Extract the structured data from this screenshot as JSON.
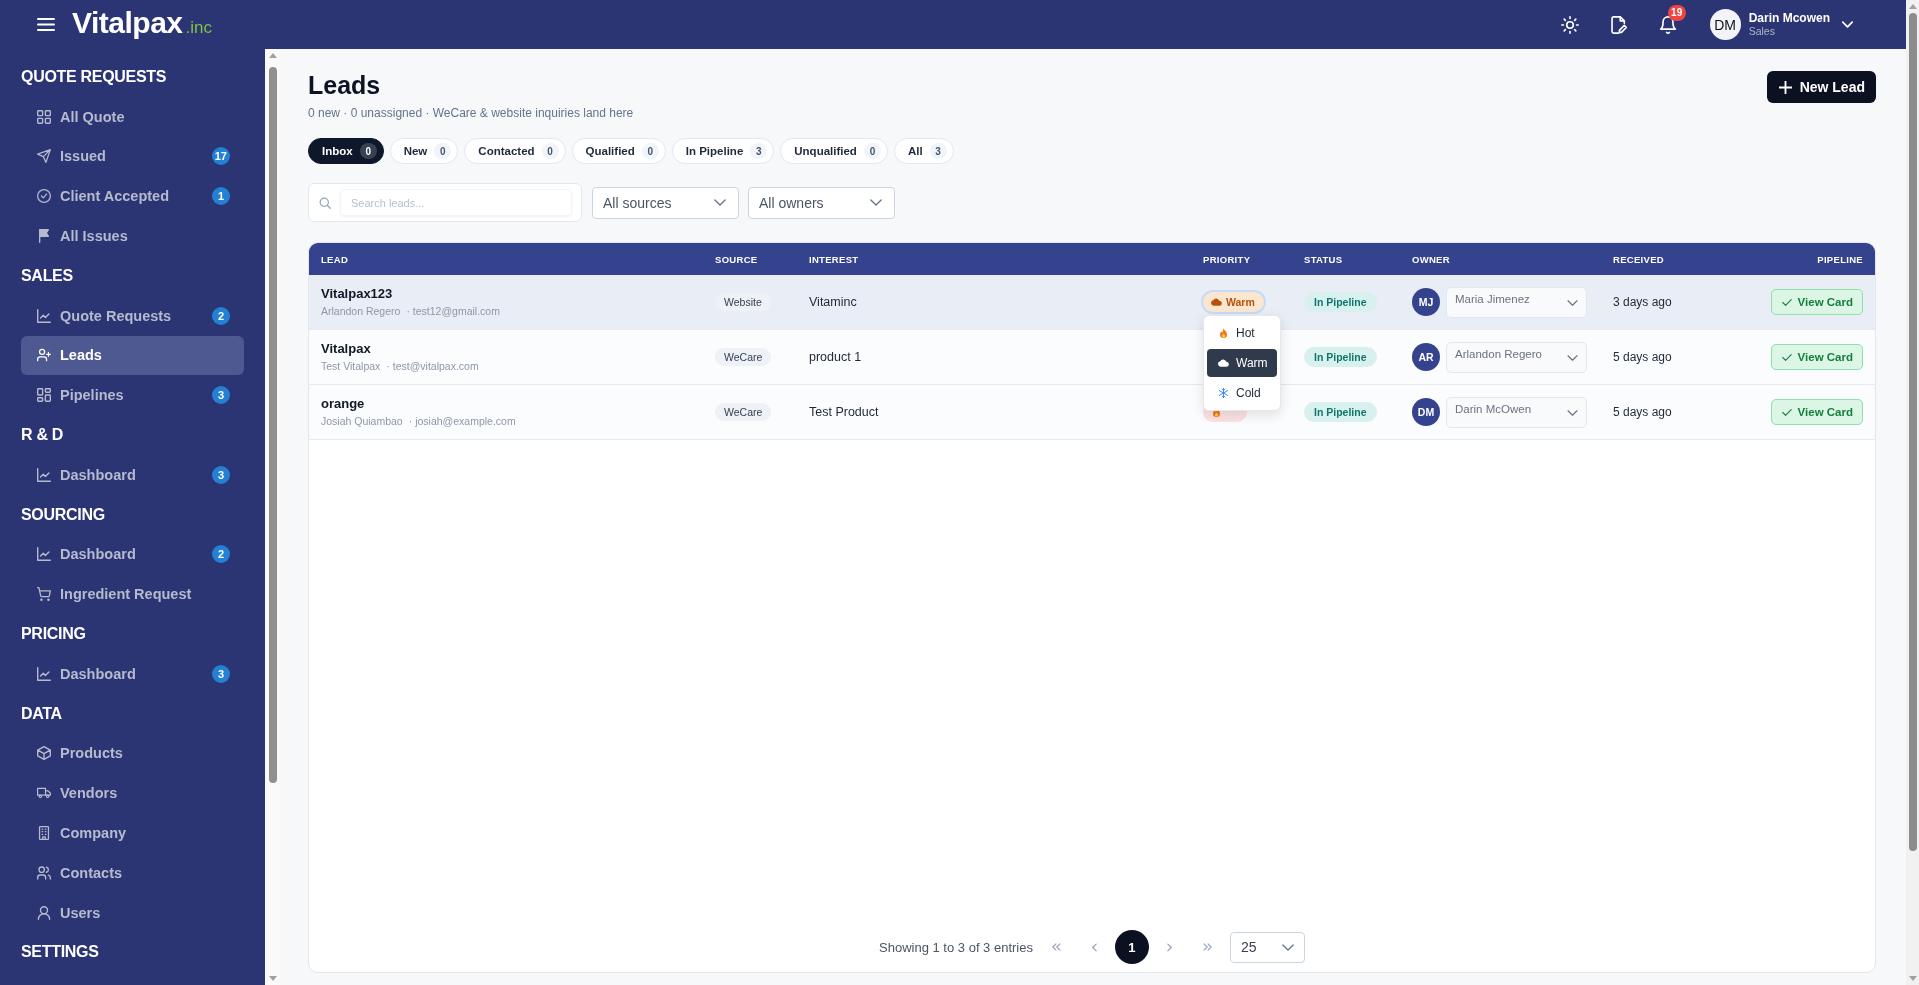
{
  "topbar": {
    "logo": {
      "name": "Vitalpax",
      "suffix": ".inc"
    },
    "notifications": "19",
    "user": {
      "initials": "DM",
      "name": "Darin Mcowen",
      "role": "Sales"
    }
  },
  "sidebar": {
    "sections": [
      {
        "title": "QUOTE REQUESTS",
        "items": [
          {
            "label": "All Quote",
            "selected": false
          },
          {
            "label": "Issued",
            "badge": "17",
            "selected": false
          },
          {
            "label": "Client Accepted",
            "badge": "1",
            "selected": false
          },
          {
            "label": "All Issues",
            "selected": false
          }
        ]
      },
      {
        "title": "SALES",
        "items": [
          {
            "label": "Quote Requests",
            "badge": "2",
            "selected": false
          },
          {
            "label": "Leads",
            "selected": true
          },
          {
            "label": "Pipelines",
            "badge": "3",
            "selected": false
          }
        ]
      },
      {
        "title": "R & D",
        "items": [
          {
            "label": "Dashboard",
            "badge": "3",
            "selected": false
          }
        ]
      },
      {
        "title": "SOURCING",
        "items": [
          {
            "label": "Dashboard",
            "badge": "2",
            "selected": false
          },
          {
            "label": "Ingredient Request",
            "selected": false
          }
        ]
      },
      {
        "title": "PRICING",
        "items": [
          {
            "label": "Dashboard",
            "badge": "3",
            "selected": false
          }
        ]
      },
      {
        "title": "DATA",
        "items": [
          {
            "label": "Products",
            "selected": false
          },
          {
            "label": "Vendors",
            "selected": false
          },
          {
            "label": "Company",
            "selected": false
          },
          {
            "label": "Contacts",
            "selected": false
          },
          {
            "label": "Users",
            "selected": false
          }
        ]
      },
      {
        "title": "SETTINGS"
      }
    ]
  },
  "page": {
    "title": "Leads",
    "subtitle": "0 new · 0 unassigned · WeCare & website inquiries land here",
    "new_button": "New Lead"
  },
  "tabs": [
    {
      "label": "Inbox",
      "count": "0",
      "selected": true
    },
    {
      "label": "New",
      "count": "0",
      "selected": false
    },
    {
      "label": "Contacted",
      "count": "0",
      "selected": false
    },
    {
      "label": "Qualified",
      "count": "0",
      "selected": false
    },
    {
      "label": "In Pipeline",
      "count": "3",
      "selected": false
    },
    {
      "label": "Unqualified",
      "count": "0",
      "selected": false
    },
    {
      "label": "All",
      "count": "3",
      "selected": false
    }
  ],
  "search": {
    "placeholder": "Search leads..."
  },
  "filters": [
    {
      "value": "All sources"
    },
    {
      "value": "All owners"
    }
  ],
  "table": {
    "columns": [
      "LEAD",
      "SOURCE",
      "INTEREST",
      "PRIORITY",
      "STATUS",
      "OWNER",
      "RECEIVED",
      "PIPELINE"
    ],
    "rows": [
      {
        "hovered": true,
        "lead": "Vitalpax123",
        "contact": "Arlandon Regero",
        "email": "· test12@gmail.com",
        "source": "Website",
        "interest": "Vitaminc",
        "priority": {
          "label": "Warm",
          "kind": "warm",
          "menu": [
            {
              "label": "Hot",
              "kind": "hot",
              "selected": false
            },
            {
              "label": "Warm",
              "kind": "warm",
              "selected": true
            },
            {
              "label": "Cold",
              "kind": "cold",
              "selected": false
            }
          ]
        },
        "status": "In Pipeline",
        "owner": {
          "initials": "MJ",
          "value": "Maria Jimenez"
        },
        "received": "3 days ago",
        "action": "View Card"
      },
      {
        "hovered": false,
        "lead": "Vitalpax",
        "contact": "Test Vitalpax",
        "email": "· test@vitalpax.com",
        "source": "WeCare",
        "interest": "product 1",
        "status": "In Pipeline",
        "owner": {
          "initials": "AR",
          "value": "Arlandon Regero"
        },
        "received": "5 days ago",
        "action": "View Card"
      },
      {
        "hovered": false,
        "lead": "orange",
        "contact": "Josiah Quiambao",
        "email": "· josiah@example.com",
        "source": "WeCare",
        "interest": "Test Product",
        "priority": {
          "kind": "hot"
        },
        "status": "In Pipeline",
        "owner": {
          "initials": "DM",
          "value": "Darin McOwen"
        },
        "received": "5 days ago",
        "action": "View Card"
      }
    ]
  },
  "pagination": {
    "summary": "Showing 1 to 3 of 3 entries",
    "pages": [
      {
        "label": "1",
        "selected": true
      }
    ],
    "page_size": "25"
  }
}
